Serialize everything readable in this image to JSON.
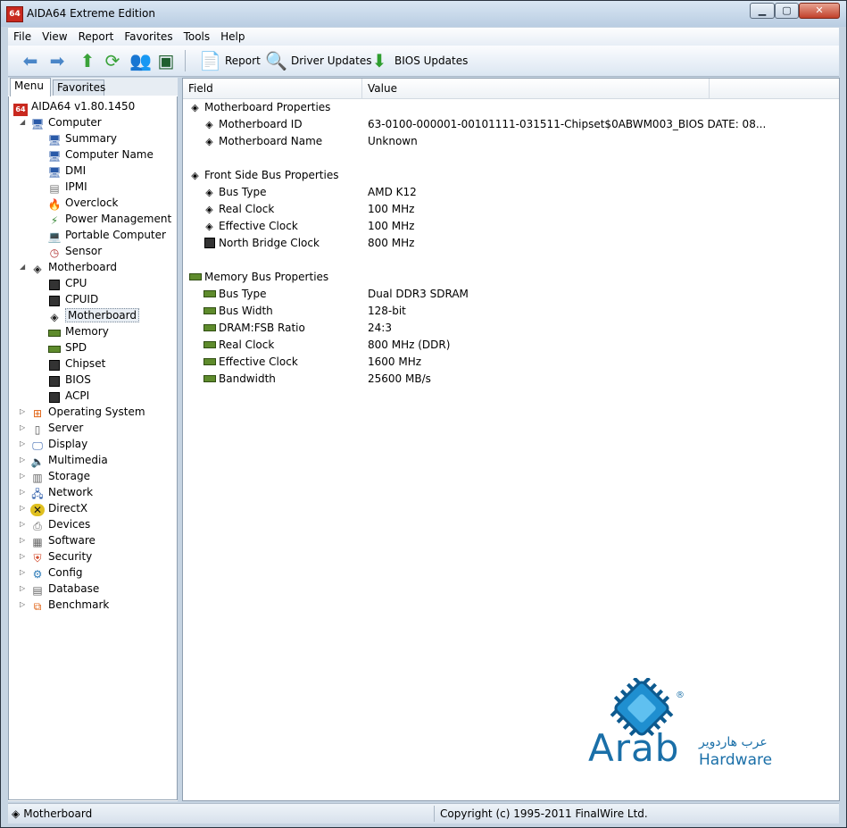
{
  "window": {
    "title": "AIDA64 Extreme Edition",
    "app_icon_text": "64"
  },
  "menubar": [
    "File",
    "View",
    "Report",
    "Favorites",
    "Tools",
    "Help"
  ],
  "toolbar": {
    "report": "Report",
    "driver_updates": "Driver Updates",
    "bios_updates": "BIOS Updates"
  },
  "tabs": {
    "menu": "Menu",
    "favorites": "Favorites"
  },
  "tree": {
    "root": "AIDA64 v1.80.1450",
    "computer": "Computer",
    "computer_items": [
      "Summary",
      "Computer Name",
      "DMI",
      "IPMI",
      "Overclock",
      "Power Management",
      "Portable Computer",
      "Sensor"
    ],
    "motherboard": "Motherboard",
    "motherboard_items": [
      "CPU",
      "CPUID",
      "Motherboard",
      "Memory",
      "SPD",
      "Chipset",
      "BIOS",
      "ACPI"
    ],
    "top_items": [
      "Operating System",
      "Server",
      "Display",
      "Multimedia",
      "Storage",
      "Network",
      "DirectX",
      "Devices",
      "Software",
      "Security",
      "Config",
      "Database",
      "Benchmark"
    ]
  },
  "table": {
    "col_field": "Field",
    "col_value": "Value",
    "groups": [
      {
        "title": "Motherboard Properties",
        "rows": [
          {
            "field": "Motherboard ID",
            "value": "63-0100-000001-00101111-031511-Chipset$0ABWM003_BIOS DATE: 08..."
          },
          {
            "field": "Motherboard Name",
            "value": "Unknown"
          }
        ]
      },
      {
        "title": "Front Side Bus Properties",
        "rows": [
          {
            "field": "Bus Type",
            "value": "AMD K12"
          },
          {
            "field": "Real Clock",
            "value": "100 MHz"
          },
          {
            "field": "Effective Clock",
            "value": "100 MHz"
          },
          {
            "field": "North Bridge Clock",
            "value": "800 MHz"
          }
        ]
      },
      {
        "title": "Memory Bus Properties",
        "rows": [
          {
            "field": "Bus Type",
            "value": "Dual DDR3 SDRAM"
          },
          {
            "field": "Bus Width",
            "value": "128-bit"
          },
          {
            "field": "DRAM:FSB Ratio",
            "value": "24:3"
          },
          {
            "field": "Real Clock",
            "value": "800 MHz (DDR)"
          },
          {
            "field": "Effective Clock",
            "value": "1600 MHz"
          },
          {
            "field": "Bandwidth",
            "value": "25600 MB/s"
          }
        ]
      }
    ]
  },
  "statusbar": {
    "left": "Motherboard",
    "right": "Copyright (c) 1995-2011 FinalWire Ltd."
  },
  "watermark": {
    "text": "Arab",
    "sub": "Hardware",
    "arabic": "عرب هاردوير",
    "reg": "®"
  }
}
